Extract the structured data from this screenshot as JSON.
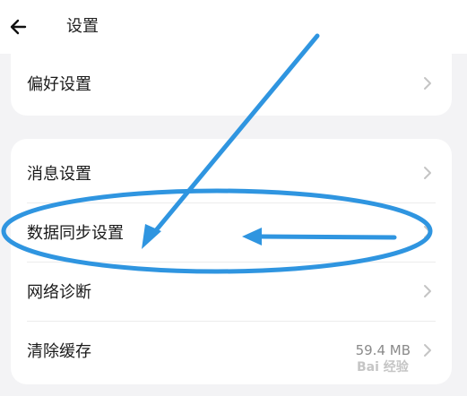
{
  "header": {
    "title": "设置",
    "back_icon": "arrow-left-icon"
  },
  "sections": [
    {
      "items": [
        {
          "label": "偏好设置",
          "value": ""
        }
      ]
    },
    {
      "items": [
        {
          "label": "消息设置",
          "value": ""
        },
        {
          "label": "数据同步设置",
          "value": ""
        },
        {
          "label": "网络诊断",
          "value": ""
        },
        {
          "label": "清除缓存",
          "value": "59.4 MB"
        }
      ]
    }
  ],
  "annotation": {
    "color": "#2f95e0",
    "highlighted_item": "数据同步设置"
  },
  "watermark": {
    "text": "Bai 经验"
  },
  "colors": {
    "background": "#f3f3f5",
    "card": "#ffffff",
    "chevron": "#c4c4c4"
  }
}
